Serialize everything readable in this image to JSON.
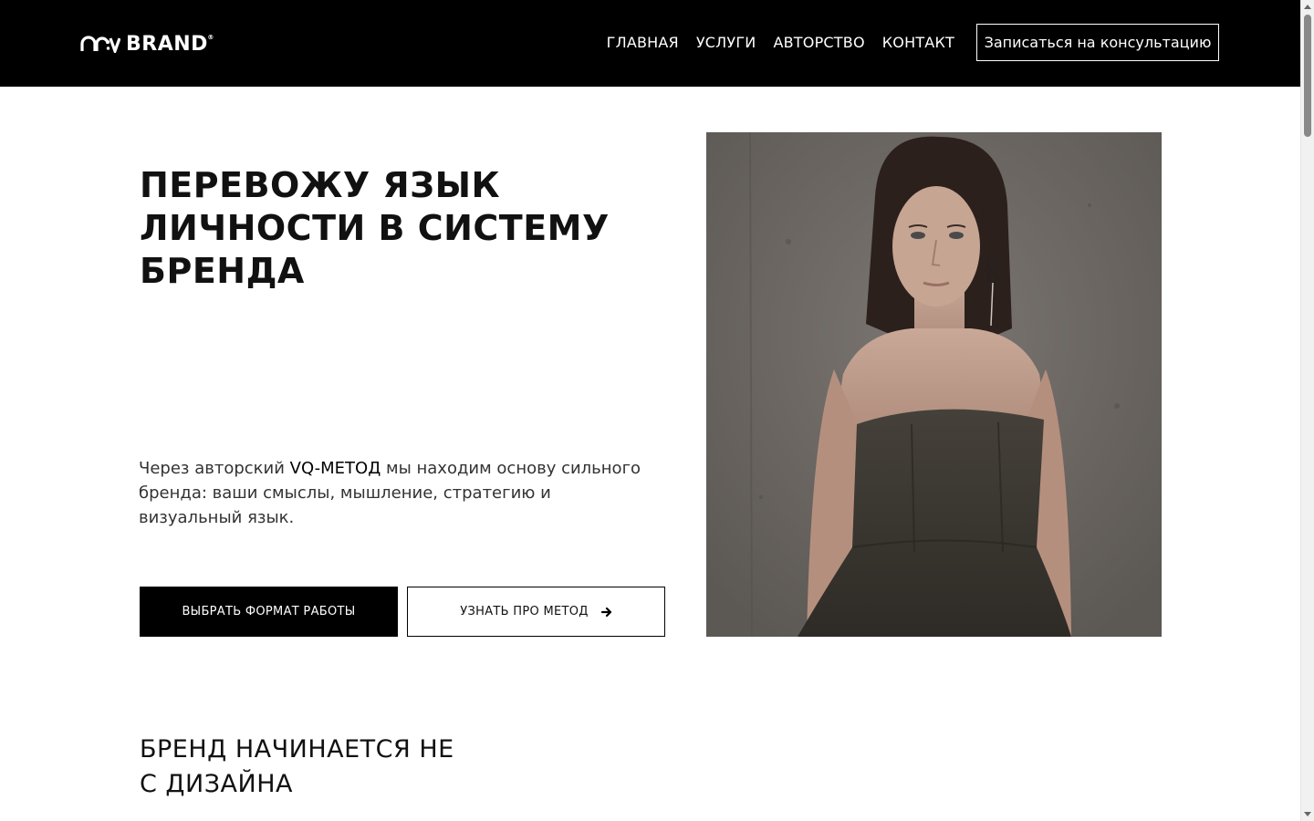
{
  "header": {
    "logo_text": "BRAND",
    "logo_mark": "an:v",
    "logo_reg": "®",
    "nav": [
      "ГЛАВНАЯ",
      "УСЛУГИ",
      "АВТОРСТВО",
      "КОНТАКТ"
    ],
    "cta_label": "Записаться на консультацию"
  },
  "hero": {
    "title_lines": [
      "ПЕРЕВОЖУ ЯЗЫК",
      "ЛИЧНОСТИ В СИСТЕМУ",
      "БРЕНДА"
    ],
    "desc_before": "Через авторский ",
    "desc_accent": "VQ-МЕТОД",
    "desc_after": " мы находим основу сильного бренда: ваши смыслы, мышление, стратегию и визуальный язык.",
    "primary_button": "ВЫБРАТЬ ФОРМАТ РАБОТЫ",
    "secondary_button": "УЗНАТЬ ПРО МЕТОД",
    "secondary_icon": "arrow-right-icon",
    "photo": "portrait-photo"
  },
  "section2": {
    "title_lines": [
      "БРЕНД НАЧИНАЕТСЯ НЕ",
      "С ДИЗАЙНА"
    ]
  },
  "colors": {
    "header_bg": "#000000",
    "page_bg": "#ffffff",
    "text": "#111111",
    "photo_wall": "#6f6a66",
    "dress": "#3f3b33"
  }
}
